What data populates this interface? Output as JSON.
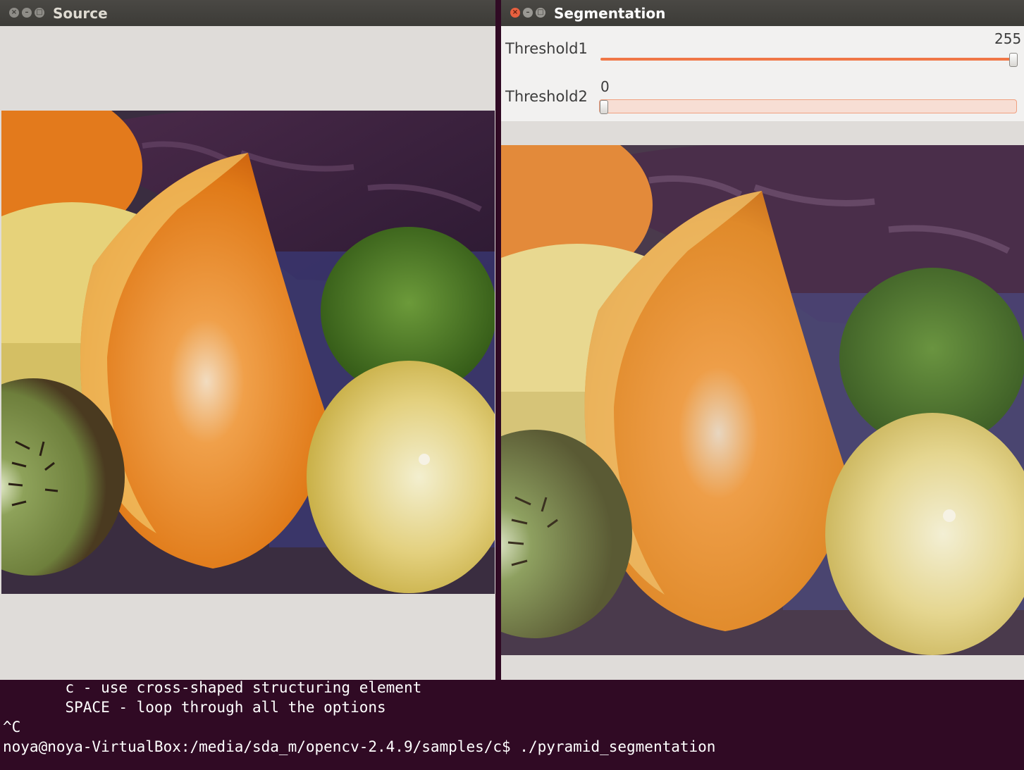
{
  "terminal": {
    "lines": [
      "       c - use cross-shaped structuring element",
      "       SPACE - loop through all the options",
      "^C",
      "noya@noya-VirtualBox:/media/sda_m/opencv-2.4.9/samples/c$ ./pyramid_segmentation"
    ]
  },
  "source_window": {
    "title": "Source"
  },
  "segmentation_window": {
    "title": "Segmentation",
    "trackbars": [
      {
        "label": "Threshold1",
        "value": "255",
        "max": 255
      },
      {
        "label": "Threshold2",
        "value": "0",
        "max": 255
      }
    ]
  },
  "colors": {
    "terminal_bg": "#300a24",
    "slider_accent": "#f07746",
    "titlebar_bg": "#3c3b37",
    "close_button_active": "#e8603f"
  },
  "icons": [
    "close-icon",
    "minimize-icon",
    "maximize-icon"
  ]
}
